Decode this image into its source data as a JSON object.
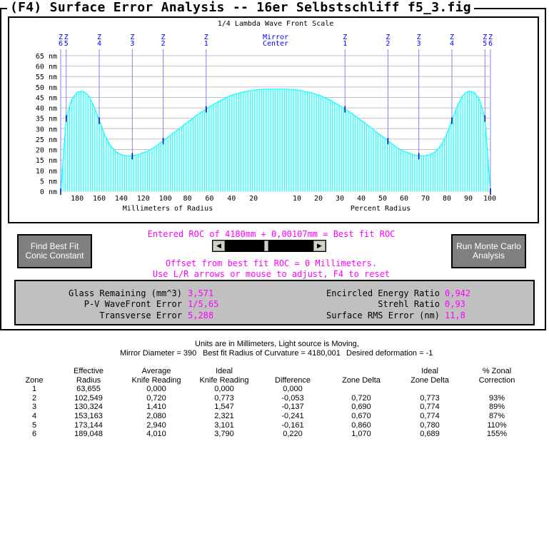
{
  "title": "(F4) Surface Error Analysis -- 16er Selbstschliff f5_3.fig",
  "chart": {
    "scale_label": "1/4 Lambda Wave Front Scale",
    "mirror_center_label": [
      "Mirror",
      "Center"
    ],
    "zone_markers_left": [
      [
        "Z",
        "6"
      ],
      [
        "Z",
        "5"
      ],
      [
        "Z",
        "4"
      ],
      [
        "Z",
        "3"
      ],
      [
        "Z",
        "2"
      ],
      [
        "Z",
        "1"
      ]
    ],
    "zone_markers_right": [
      [
        "Z",
        "1"
      ],
      [
        "Z",
        "2"
      ],
      [
        "Z",
        "3"
      ],
      [
        "Z",
        "4"
      ],
      [
        "Z",
        "5"
      ],
      [
        "Z",
        "6"
      ]
    ],
    "y_ticks": [
      "65 nm",
      "60 nm",
      "55 nm",
      "50 nm",
      "45 nm",
      "40 nm",
      "35 nm",
      "30 nm",
      "25 nm",
      "20 nm",
      "15 nm",
      "10 nm",
      "5 nm",
      "0 nm"
    ],
    "x_ticks_left": [
      "180",
      "160",
      "140",
      "120",
      "100",
      "80",
      "60",
      "40",
      "20"
    ],
    "x_ticks_right": [
      "10",
      "20",
      "30",
      "40",
      "50",
      "60",
      "70",
      "80",
      "90",
      "100"
    ],
    "xlabel_left": "Millimeters of Radius",
    "xlabel_right": "Percent Radius",
    "fill_color": "#00ffff",
    "zone_color": "#0000ff",
    "grid_color": "#c0c0c0"
  },
  "chart_data": {
    "type": "area",
    "title": "1/4 Lambda Wave Front Scale",
    "xlabel": "Millimeters of Radius",
    "ylabel": "",
    "ylim": [
      0,
      65
    ],
    "x_mm": [
      195,
      190,
      185,
      180,
      175,
      170,
      165,
      160,
      155,
      150,
      145,
      140,
      135,
      130,
      125,
      120,
      115,
      110,
      100,
      90,
      80,
      70,
      60,
      50,
      40,
      30,
      20,
      10,
      0
    ],
    "values_nm": [
      0,
      35,
      44,
      47.5,
      48,
      46,
      41,
      34,
      27,
      22,
      19,
      17.5,
      17,
      17,
      17.5,
      18.5,
      19.5,
      21,
      25,
      29,
      33,
      37,
      40.5,
      43.5,
      46,
      47.5,
      48.5,
      49,
      49
    ]
  },
  "controls": {
    "conic_button": "Find Best Fit Conic Constant",
    "monte_button": "Run Monte Carlo Analysis",
    "roc_text": "Entered ROC of 4180mm + 0,00107mm = Best fit ROC",
    "offset_text": "Offset from best fit ROC = 0 Millimeters.",
    "adjust_text": "Use L/R arrows or mouse to adjust, F4 to reset",
    "slider_position": 0.47
  },
  "stats": {
    "glass_label": "Glass Remaining (mm^3)",
    "glass_value": "3,571",
    "pv_label": "P-V WaveFront Error",
    "pv_value": "1/5,65",
    "trans_label": "Transverse Error",
    "trans_value": "5,288",
    "ee_label": "Encircled Energy Ratio",
    "ee_value": "0,942",
    "strehl_label": "Strehl Ratio",
    "strehl_value": "0,93",
    "rms_label": "Surface RMS Error (nm)",
    "rms_value": "11,8"
  },
  "info": {
    "line1": "Units are in Millimeters, Light source is Moving,",
    "diameter": "Mirror Diameter = 390",
    "roc": "Best fit Radius of Curvature = 4180,001",
    "deformation": "Desired deformation = -1"
  },
  "table": {
    "headers_top": [
      "",
      "Effective",
      "Average",
      "Ideal",
      "",
      "",
      "Ideal",
      "% Zonal"
    ],
    "headers_bottom": [
      "Zone",
      "Radius",
      "Knife Reading",
      "Knife Reading",
      "Difference",
      "Zone Delta",
      "Zone Delta",
      "Correction"
    ],
    "rows": [
      [
        "1",
        "63,655",
        "0,000",
        "0,000",
        "0,000",
        "",
        "",
        ""
      ],
      [
        "2",
        "102,549",
        "0,720",
        "0,773",
        "-0,053",
        "0,720",
        "0,773",
        "93%"
      ],
      [
        "3",
        "130,324",
        "1,410",
        "1,547",
        "-0,137",
        "0,690",
        "0,774",
        "89%"
      ],
      [
        "4",
        "153,163",
        "2,080",
        "2,321",
        "-0,241",
        "0,670",
        "0,774",
        "87%"
      ],
      [
        "5",
        "173,144",
        "2,940",
        "3,101",
        "-0,161",
        "0,860",
        "0,780",
        "110%"
      ],
      [
        "6",
        "189,048",
        "4,010",
        "3,790",
        "0,220",
        "1,070",
        "0,689",
        "155%"
      ]
    ]
  }
}
